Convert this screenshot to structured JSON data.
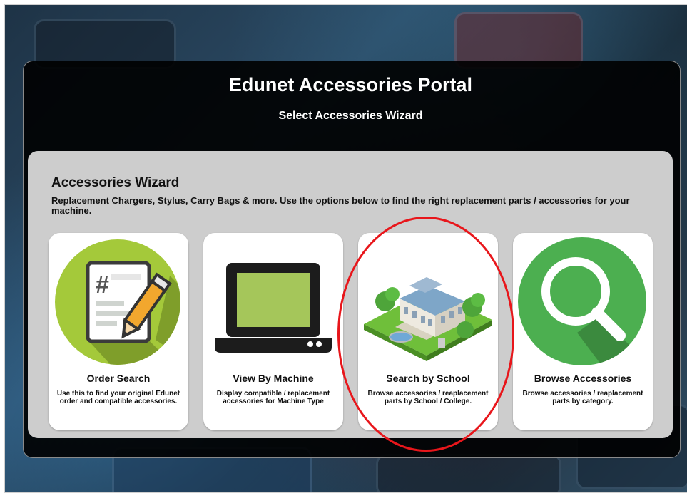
{
  "portal": {
    "title": "Edunet Accessories Portal",
    "subtitle": "Select Accessories Wizard"
  },
  "wizard": {
    "heading": "Accessories Wizard",
    "description": "Replacement Chargers, Stylus, Carry Bags & more. Use the options below to find the right replacement parts / accessories for your machine."
  },
  "cards": [
    {
      "title": "Order Search",
      "description": "Use this to find your original Edunet order and compatible accessories.",
      "icon": "order-document-icon"
    },
    {
      "title": "View By Machine",
      "description": "Display compatible / replacement accessories for Machine Type",
      "icon": "laptop-icon"
    },
    {
      "title": "Search by School",
      "description": "Browse accessories / reaplacement parts by School / College.",
      "icon": "school-building-icon"
    },
    {
      "title": "Browse Accessories",
      "description": "Browse accessories / reaplacement parts by category.",
      "icon": "magnifier-icon"
    }
  ],
  "colors": {
    "panel_bg": "#000000",
    "wizard_bg": "#cdcdcd",
    "order_green": "#a4c93a",
    "browse_green": "#4caf50",
    "highlight_red": "#e8161b"
  }
}
